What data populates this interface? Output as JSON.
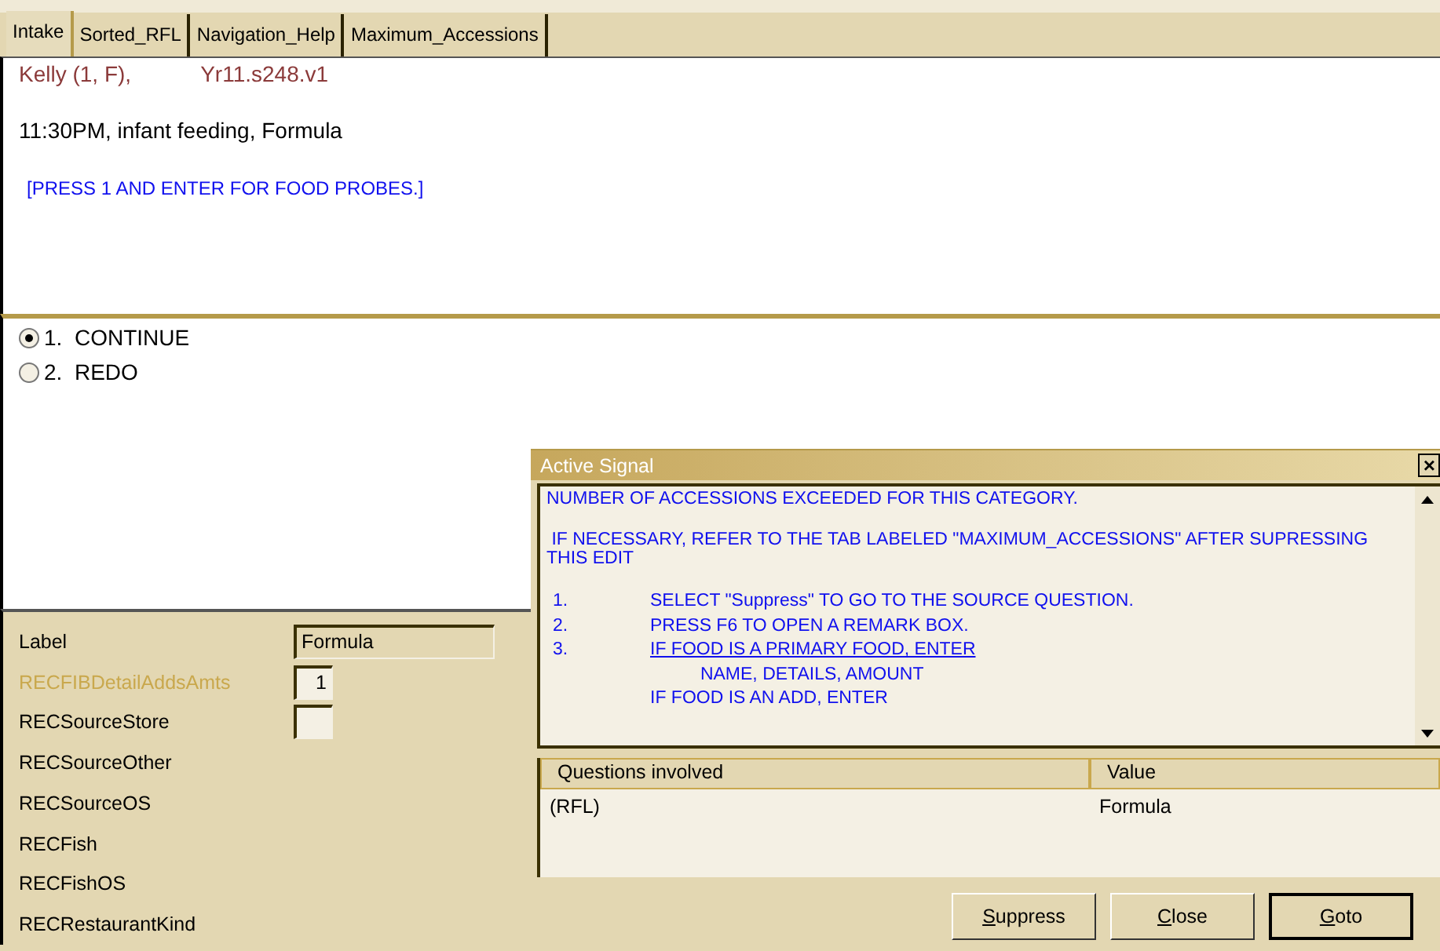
{
  "tabs": [
    {
      "label": "Intake",
      "selected": true
    },
    {
      "label": "Sorted_RFL",
      "selected": false
    },
    {
      "label": "Navigation_Help",
      "selected": false
    },
    {
      "label": "Maximum_Accessions",
      "selected": false
    }
  ],
  "question": {
    "respondent": "Kelly (1, F),",
    "version": "Yr11.s248.v1",
    "context": "11:30PM, infant feeding, Formula",
    "instruction": "[PRESS 1 AND ENTER FOR FOOD PROBES.]"
  },
  "answers": [
    {
      "label": "1.  CONTINUE",
      "selected": true
    },
    {
      "label": "2.  REDO",
      "selected": false
    }
  ],
  "fields": [
    {
      "name": "Label",
      "greyed": false,
      "kind": "wide",
      "value": "Formula"
    },
    {
      "name": "RECFIBDetailAddsAmts",
      "greyed": true,
      "kind": "small",
      "value": "1"
    },
    {
      "name": "RECSourceStore",
      "greyed": false,
      "kind": "small"
    },
    {
      "name": "RECSourceOther",
      "greyed": false,
      "kind": "none"
    },
    {
      "name": "RECSourceOS",
      "greyed": false,
      "kind": "none"
    },
    {
      "name": "RECFish",
      "greyed": false,
      "kind": "none"
    },
    {
      "name": "RECFishOS",
      "greyed": false,
      "kind": "none"
    },
    {
      "name": "RECRestaurantKind",
      "greyed": false,
      "kind": "none"
    }
  ],
  "dialog": {
    "title": "Active Signal",
    "close": "×",
    "message": [
      "NUMBER OF ACCESSIONS EXCEEDED FOR THIS CATEGORY.",
      " IF NECESSARY, REFER TO THE TAB LABELED \"MAXIMUM_ACCESSIONS\" AFTER SUPRESSING THIS EDIT"
    ],
    "steps": [
      {
        "number": "1.",
        "text": "SELECT \"Suppress\" TO GO TO THE SOURCE QUESTION.",
        "underlined": false
      },
      {
        "number": "2.",
        "text": "PRESS F6 TO OPEN A REMARK BOX.",
        "underlined": false
      },
      {
        "number": "3.",
        "text": "IF FOOD IS A PRIMARY FOOD, ENTER",
        "underlined": true
      },
      {
        "text": "          NAME, DETAILS, AMOUNT",
        "underlined": false
      },
      {
        "text": "IF FOOD IS AN ADD, ENTER",
        "underlined": false
      }
    ],
    "columns": [
      "Questions involved",
      "Value"
    ],
    "rows": [
      [
        "(RFL)",
        "Formula"
      ]
    ],
    "buttons": [
      {
        "label": "Suppress",
        "default": false
      },
      {
        "label": "Close",
        "default": false
      },
      {
        "label": "Goto",
        "default": true
      }
    ]
  }
}
